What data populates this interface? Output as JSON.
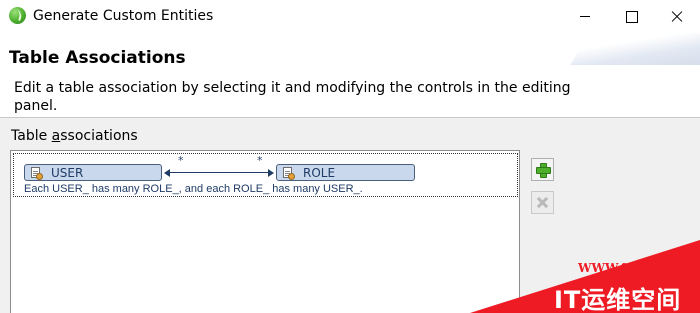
{
  "window": {
    "title": "Generate Custom Entities"
  },
  "header": {
    "title": "Table Associations",
    "description": "Edit a table association by selecting it and modifying the controls in the editing panel."
  },
  "associations": {
    "label_pre": "Table ",
    "label_mnemonic": "a",
    "label_post": "ssociations",
    "items": [
      {
        "source": "USER",
        "target": "ROLE",
        "source_multiplicity": "*",
        "target_multiplicity": "*",
        "description": "Each USER_ has many ROLE_, and each ROLE_ has many USER_."
      }
    ]
  },
  "watermark": {
    "url": "WWW.94IP.COM",
    "text": "IT运维空间"
  },
  "colors": {
    "entity_fill": "#c9d8ec",
    "link_color": "#1f3b66",
    "add_green": "#4fae2c",
    "watermark_red": "#ee1b24"
  }
}
